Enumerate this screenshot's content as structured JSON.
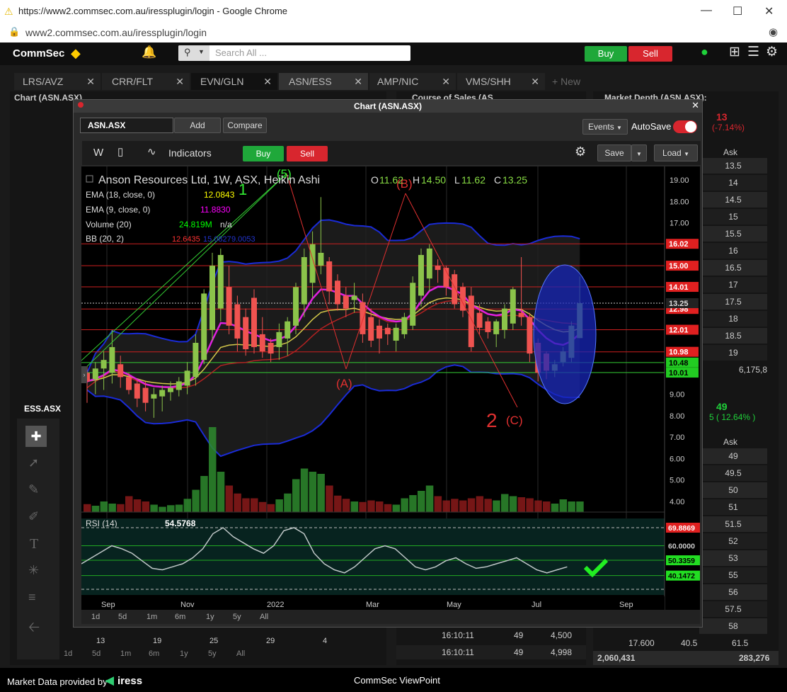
{
  "browser": {
    "title": "https://www2.commsec.com.au/iressplugin/login - Google Chrome",
    "url": "www2.commsec.com.au/iressplugin/login"
  },
  "app": {
    "brand": "CommSec",
    "search_placeholder": "Search All ...",
    "buy": "Buy",
    "sell": "Sell"
  },
  "tabs": [
    "LRS/AVZ",
    "CRR/FLT",
    "EVN/GLN",
    "ASN/ESS",
    "AMP/NIC",
    "VMS/SHH"
  ],
  "new_tab": "+ New",
  "left_panel": {
    "title": "Chart (ASN.ASX)",
    "sub_label": "ESS.ASX",
    "x_labels": [
      "13",
      "19",
      "25",
      "29",
      "4"
    ],
    "periods": [
      "1d",
      "5d",
      "1m",
      "6m",
      "1y",
      "5y",
      "All"
    ]
  },
  "cos_panel": {
    "title": "Course of Sales (AS",
    "rows": [
      {
        "time": "16:10:11",
        "qty": "49",
        "vol": "4,500"
      },
      {
        "time": "16:10:11",
        "qty": "49",
        "vol": "4,998"
      }
    ]
  },
  "depth_panel": {
    "title": "Market Depth (ASN.ASX):",
    "top_price": "13",
    "top_change": "(-7.14%)",
    "ask_label": "Ask",
    "asks_top": [
      "13.5",
      "14",
      "14.5",
      "15",
      "15.5",
      "16",
      "16.5",
      "17",
      "17.5",
      "18",
      "18.5",
      "19"
    ],
    "top_total": "6,175,8",
    "second_price": "49",
    "second_change": "5 ( 12.64% )",
    "asks_bottom": [
      "49",
      "49.5",
      "50",
      "51",
      "51.5",
      "52",
      "53",
      "55",
      "56",
      "57.5",
      "58",
      "61.5"
    ],
    "bottom_row": [
      "17.600",
      "40.5"
    ],
    "bottom_totals": [
      "2,060,431",
      "283,276"
    ]
  },
  "chart_window": {
    "title": "Chart (ASN.ASX)",
    "symbol": "ASN.ASX",
    "add": "Add",
    "compare": "Compare",
    "events": "Events",
    "autosave": "AutoSave",
    "interval": "W",
    "indicators": "Indicators",
    "buy": "Buy",
    "sell": "Sell",
    "save": "Save",
    "load": "Load",
    "legend_title": "Anson Resources Ltd, 1W, ASX, Heikin Ashi",
    "ohlc": {
      "o_label": "O",
      "o": "11.62",
      "h_label": "H",
      "h": "14.50",
      "l_label": "L",
      "l": "11.62",
      "c_label": "C",
      "c": "13.25"
    },
    "studies": [
      {
        "label": "EMA (18, close, 0)",
        "value": "12.0843",
        "color": "#ffff00"
      },
      {
        "label": "EMA (9, close, 0)",
        "value": "11.8830",
        "color": "#ff00ff"
      },
      {
        "label": "Volume (20)",
        "value": "24.819M",
        "extra": "n/a",
        "color": "#00ff00"
      },
      {
        "label": "BB (20, 2)",
        "value": "12.6435",
        "value2": "15.0827",
        "value3": "9.0053",
        "color": "#ff3333"
      }
    ],
    "rsi_label": "RSI (14)",
    "rsi_value": "54.5768",
    "periods": [
      "1d",
      "5d",
      "1m",
      "6m",
      "1y",
      "5y",
      "All"
    ]
  },
  "chart_data": {
    "type": "candlestick",
    "x_ticks": [
      "Sep",
      "Nov",
      "2022",
      "Mar",
      "May",
      "Jul",
      "Sep"
    ],
    "ylim": [
      3.5,
      19.3
    ],
    "y_ticks": [
      "19.00",
      "18.00",
      "17.00",
      "9.00",
      "8.00",
      "7.00",
      "6.00",
      "5.00",
      "4.00"
    ],
    "price_levels": [
      {
        "value": 16.02,
        "label": "16.02"
      },
      {
        "value": 15.0,
        "label": "15.00"
      },
      {
        "value": 14.01,
        "label": "14.01"
      },
      {
        "value": 12.98,
        "label": "12.98"
      },
      {
        "value": 12.01,
        "label": "12.01"
      },
      {
        "value": 10.98,
        "label": "10.98"
      }
    ],
    "support_levels": [
      {
        "value": 10.48,
        "label": "10.48"
      },
      {
        "value": 10.01,
        "label": "10.01"
      }
    ],
    "last_price": {
      "value": 13.25,
      "label": "13.25"
    },
    "candles": [
      {
        "o": 10.0,
        "h": 10.3,
        "l": 8.6,
        "c": 9.6
      },
      {
        "o": 9.7,
        "h": 10.5,
        "l": 9.0,
        "c": 10.2
      },
      {
        "o": 10.2,
        "h": 11.0,
        "l": 9.2,
        "c": 10.6
      },
      {
        "o": 10.0,
        "h": 12.0,
        "l": 9.5,
        "c": 11.2
      },
      {
        "o": 10.4,
        "h": 10.8,
        "l": 9.3,
        "c": 9.8
      },
      {
        "o": 9.8,
        "h": 10.0,
        "l": 9.0,
        "c": 9.2
      },
      {
        "o": 9.5,
        "h": 9.7,
        "l": 8.4,
        "c": 8.8
      },
      {
        "o": 9.3,
        "h": 9.6,
        "l": 8.2,
        "c": 8.6
      },
      {
        "o": 8.8,
        "h": 9.3,
        "l": 7.9,
        "c": 9.0
      },
      {
        "o": 8.9,
        "h": 9.4,
        "l": 8.2,
        "c": 9.2
      },
      {
        "o": 9.1,
        "h": 9.6,
        "l": 8.7,
        "c": 9.3
      },
      {
        "o": 9.2,
        "h": 9.8,
        "l": 8.9,
        "c": 9.6
      },
      {
        "o": 9.4,
        "h": 10.5,
        "l": 9.0,
        "c": 10.1
      },
      {
        "o": 9.8,
        "h": 11.8,
        "l": 9.4,
        "c": 11.4
      },
      {
        "o": 10.6,
        "h": 13.9,
        "l": 10.4,
        "c": 13.7
      },
      {
        "o": 12.0,
        "h": 15.6,
        "l": 11.5,
        "c": 15.0
      },
      {
        "o": 13.0,
        "h": 15.8,
        "l": 12.4,
        "c": 15.5
      },
      {
        "o": 14.0,
        "h": 15.0,
        "l": 11.8,
        "c": 12.2
      },
      {
        "o": 13.2,
        "h": 13.6,
        "l": 11.0,
        "c": 11.6
      },
      {
        "o": 12.6,
        "h": 13.0,
        "l": 10.8,
        "c": 11.1
      },
      {
        "o": 13.5,
        "h": 13.9,
        "l": 10.9,
        "c": 11.2
      },
      {
        "o": 11.8,
        "h": 12.6,
        "l": 10.7,
        "c": 11.0
      },
      {
        "o": 11.4,
        "h": 11.6,
        "l": 10.5,
        "c": 10.9
      },
      {
        "o": 11.2,
        "h": 12.3,
        "l": 10.6,
        "c": 11.9
      },
      {
        "o": 11.6,
        "h": 12.6,
        "l": 10.8,
        "c": 12.4
      },
      {
        "o": 12.2,
        "h": 14.2,
        "l": 11.8,
        "c": 14.0
      },
      {
        "o": 13.2,
        "h": 15.8,
        "l": 12.6,
        "c": 15.4
      },
      {
        "o": 14.2,
        "h": 16.6,
        "l": 13.5,
        "c": 16.0
      },
      {
        "o": 15.0,
        "h": 18.2,
        "l": 14.6,
        "c": 15.6
      },
      {
        "o": 15.2,
        "h": 15.4,
        "l": 13.2,
        "c": 13.8
      },
      {
        "o": 14.3,
        "h": 14.6,
        "l": 12.9,
        "c": 13.2
      },
      {
        "o": 13.6,
        "h": 14.0,
        "l": 12.6,
        "c": 13.0
      },
      {
        "o": 13.4,
        "h": 14.2,
        "l": 12.8,
        "c": 13.6
      },
      {
        "o": 13.3,
        "h": 13.7,
        "l": 11.4,
        "c": 11.8
      },
      {
        "o": 12.6,
        "h": 13.0,
        "l": 11.2,
        "c": 11.5
      },
      {
        "o": 12.2,
        "h": 12.5,
        "l": 10.9,
        "c": 11.6
      },
      {
        "o": 12.1,
        "h": 12.3,
        "l": 11.3,
        "c": 11.8
      },
      {
        "o": 11.5,
        "h": 12.3,
        "l": 11.0,
        "c": 12.1
      },
      {
        "o": 11.8,
        "h": 12.8,
        "l": 11.6,
        "c": 12.6
      },
      {
        "o": 12.2,
        "h": 14.5,
        "l": 12.0,
        "c": 14.2
      },
      {
        "o": 13.6,
        "h": 15.8,
        "l": 13.1,
        "c": 15.5
      },
      {
        "o": 14.4,
        "h": 16.0,
        "l": 13.8,
        "c": 15.8
      },
      {
        "o": 15.0,
        "h": 15.3,
        "l": 14.2,
        "c": 14.8
      },
      {
        "o": 14.9,
        "h": 15.0,
        "l": 13.6,
        "c": 14.0
      },
      {
        "o": 14.6,
        "h": 14.8,
        "l": 13.0,
        "c": 13.2
      },
      {
        "o": 14.0,
        "h": 14.2,
        "l": 12.6,
        "c": 12.9
      },
      {
        "o": 13.6,
        "h": 14.0,
        "l": 11.0,
        "c": 11.2
      },
      {
        "o": 12.8,
        "h": 13.2,
        "l": 11.8,
        "c": 12.1
      },
      {
        "o": 12.4,
        "h": 12.6,
        "l": 11.6,
        "c": 11.9
      },
      {
        "o": 11.8,
        "h": 12.5,
        "l": 11.2,
        "c": 12.4
      },
      {
        "o": 12.0,
        "h": 13.2,
        "l": 11.6,
        "c": 13.0
      },
      {
        "o": 12.3,
        "h": 14.0,
        "l": 12.0,
        "c": 13.9
      },
      {
        "o": 12.8,
        "h": 15.4,
        "l": 12.2,
        "c": 12.6
      },
      {
        "o": 12.6,
        "h": 12.8,
        "l": 10.5,
        "c": 10.9
      },
      {
        "o": 11.4,
        "h": 11.6,
        "l": 9.6,
        "c": 10.0
      },
      {
        "o": 10.9,
        "h": 11.0,
        "l": 9.7,
        "c": 10.1
      },
      {
        "o": 10.1,
        "h": 10.6,
        "l": 9.8,
        "c": 10.4
      },
      {
        "o": 10.5,
        "h": 11.2,
        "l": 10.3,
        "c": 11.0
      },
      {
        "o": 10.7,
        "h": 12.4,
        "l": 10.5,
        "c": 12.2
      },
      {
        "o": 11.62,
        "h": 14.5,
        "l": 11.62,
        "c": 13.25
      }
    ],
    "volume": [
      1.5,
      1.2,
      2.0,
      1.6,
      1.5,
      3.0,
      2.4,
      2.0,
      1.4,
      1.0,
      1.3,
      1.4,
      2.5,
      4.2,
      6.8,
      16.0,
      7.6,
      5.0,
      3.5,
      2.6,
      2.6,
      1.9,
      1.5,
      2.4,
      3.5,
      6.2,
      8.2,
      7.6,
      7.2,
      5.0,
      3.1,
      2.5,
      2.0,
      1.9,
      2.2,
      2.0,
      1.5,
      1.4,
      2.6,
      3.2,
      4.0,
      5.0,
      3.0,
      2.2,
      2.5,
      2.2,
      2.6,
      3.0,
      2.5,
      2.2,
      3.4,
      3.0,
      2.8,
      2.6,
      2.2,
      2.0,
      1.6,
      2.4,
      2.0,
      2.0
    ],
    "rsi": [
      48,
      52,
      56,
      60,
      58,
      55,
      50,
      45,
      44,
      46,
      48,
      52,
      58,
      68,
      72,
      66,
      62,
      58,
      55,
      60,
      70,
      72,
      68,
      55,
      48,
      44,
      42,
      46,
      52,
      58,
      60,
      58,
      52,
      46,
      44,
      46,
      50,
      52,
      48,
      45,
      46,
      48,
      50,
      52,
      48,
      44,
      42,
      44,
      46
    ],
    "rsi_levels": [
      {
        "value": 69.8869,
        "label": "69.8869"
      },
      {
        "value": 60.0,
        "label": "60.0000"
      },
      {
        "value": 50.3359,
        "label": "50.3359"
      },
      {
        "value": 40.1472,
        "label": "40.1472"
      }
    ],
    "wave_labels": [
      "(5)",
      "1",
      "(B)",
      "(A)",
      "2",
      "(C)"
    ]
  }
}
